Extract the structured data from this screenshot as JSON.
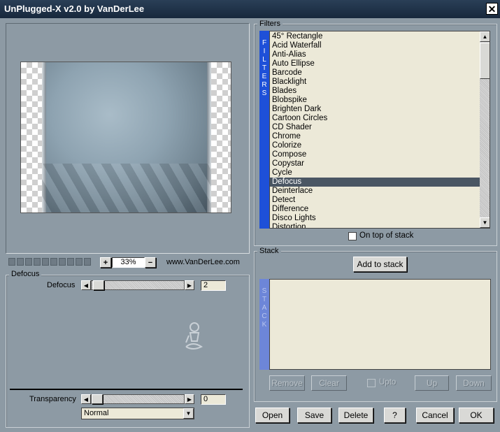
{
  "window": {
    "title": "UnPlugged-X v2.0 by VanDerLee",
    "close_glyph": "✕"
  },
  "preview": {
    "zoom_value": "33%",
    "zoom_in": "+",
    "zoom_out": "−",
    "website": "www.VanDerLee.com",
    "progress_cells": 10
  },
  "filters": {
    "group_label": "Filters",
    "vertical_label": [
      "F",
      "I",
      "L",
      "T",
      "E",
      "R",
      "S"
    ],
    "items": [
      "45° Rectangle",
      "Acid Waterfall",
      "Anti-Alias",
      "Auto Ellipse",
      "Barcode",
      "Blacklight",
      "Blades",
      "Blobspike",
      "Brighten Dark",
      "Cartoon Circles",
      "CD Shader",
      "Chrome",
      "Colorize",
      "Compose",
      "Copystar",
      "Cycle",
      "Defocus",
      "Deinterlace",
      "Detect",
      "Difference",
      "Disco Lights",
      "Distortion"
    ],
    "selected": "Defocus",
    "on_top_label": "On top of stack",
    "scroll_up": "▲",
    "scroll_down": "▼"
  },
  "params": {
    "group_label": "Defocus",
    "defocus_label": "Defocus",
    "defocus_value": "2",
    "defocus_fraction": 0.02,
    "transparency_label": "Transparency",
    "transparency_value": "0",
    "transparency_fraction": 0.0,
    "blend_mode": "Normal",
    "arrow_left": "◀",
    "arrow_right": "▶",
    "dropdown_arrow": "▼"
  },
  "stack": {
    "group_label": "Stack",
    "add_button": "Add to stack",
    "vertical_label": [
      "S",
      "T",
      "A",
      "C",
      "K"
    ],
    "remove": "Remove",
    "clear": "Clear",
    "upto": "Upto",
    "up": "Up",
    "down": "Down"
  },
  "footer": {
    "open": "Open",
    "save": "Save",
    "delete": "Delete",
    "help": "?",
    "cancel": "Cancel",
    "ok": "OK"
  }
}
